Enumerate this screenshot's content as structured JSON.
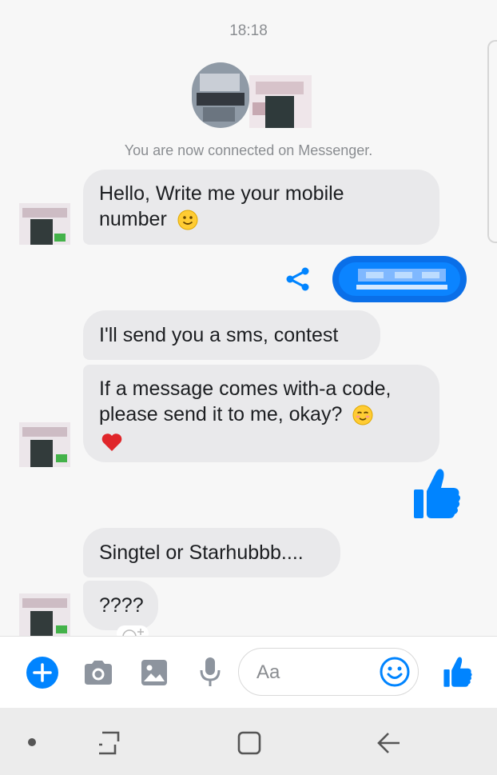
{
  "status": {
    "time": "18:18"
  },
  "conversation": {
    "system_message": "You are now connected on Messenger.",
    "messages": [
      {
        "from": "other",
        "lines": [
          "Hello, Write me your mobile",
          "number"
        ],
        "emoji": "slight-smile"
      },
      {
        "from": "me",
        "type": "shared-link",
        "text": "blurred-link"
      },
      {
        "from": "other",
        "text": "I'll send you a sms, contest"
      },
      {
        "from": "other",
        "lines": [
          "If a message comes with-a code,",
          "please send it to me, okay?"
        ],
        "emoji": "blush",
        "extra_emoji": "heart"
      },
      {
        "from": "me",
        "type": "like"
      },
      {
        "from": "other",
        "text": "Singtel or Starhubbb...."
      },
      {
        "from": "other",
        "text": "????"
      }
    ]
  },
  "composer": {
    "placeholder": "Aa"
  },
  "colors": {
    "accent": "#0084ff",
    "bubble_gray": "#e9e9eb",
    "heart": "#e0262a",
    "emoji_yellow": "#ffcc33"
  },
  "icons": [
    "plus-icon",
    "camera-icon",
    "image-icon",
    "microphone-icon",
    "smiley-icon",
    "thumbs-up-icon",
    "share-icon",
    "recent-apps-icon",
    "home-icon",
    "back-icon"
  ]
}
